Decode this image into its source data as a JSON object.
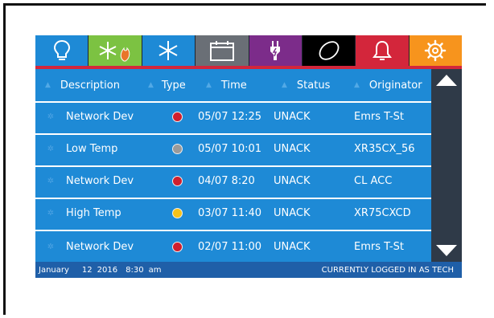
{
  "tabs": [
    {
      "name": "lightbulb-icon",
      "bg": "#1e8ad6"
    },
    {
      "name": "defrost-icon",
      "bg": "#7cc242"
    },
    {
      "name": "snowflake-icon",
      "bg": "#1e8ad6"
    },
    {
      "name": "calendar-icon",
      "bg": "#6a6f76"
    },
    {
      "name": "plug-icon",
      "bg": "#7c2c8a"
    },
    {
      "name": "ellipse-icon",
      "bg": "#000000"
    },
    {
      "name": "bell-icon",
      "bg": "#d3263b"
    },
    {
      "name": "gear-icon",
      "bg": "#f7941d"
    }
  ],
  "columns": {
    "description": "Description",
    "type": "Type",
    "time": "Time",
    "status": "Status",
    "originator": "Originator"
  },
  "rows": [
    {
      "description": "Network Dev",
      "type_color": "#d01f2e",
      "time": "05/07 12:25",
      "status": "UNACK",
      "originator": "Emrs T-St"
    },
    {
      "description": "Low Temp",
      "type_color": "#9a9a9a",
      "time": "05/07 10:01",
      "status": "UNACK",
      "originator": "XR35CX_56"
    },
    {
      "description": "Network Dev",
      "type_color": "#d01f2e",
      "time": "04/07 8:20",
      "status": "UNACK",
      "originator": "CL ACC"
    },
    {
      "description": "High Temp",
      "type_color": "#f6c21a",
      "time": "03/07 11:40",
      "status": "UNACK",
      "originator": "XR75CXCD"
    },
    {
      "description": "Network Dev",
      "type_color": "#d01f2e",
      "time": "02/07 11:00",
      "status": "UNACK",
      "originator": "Emrs T-St"
    }
  ],
  "status_bar": {
    "month": "January",
    "day": "12",
    "year": "2016",
    "time": "8:30",
    "ampm": "am",
    "login": "CURRENTLY LOGGED IN AS TECH"
  },
  "colors": {
    "accent_red": "#d3263b",
    "grid_blue": "#1e8ad6",
    "status_blue": "#1f5fa8"
  }
}
